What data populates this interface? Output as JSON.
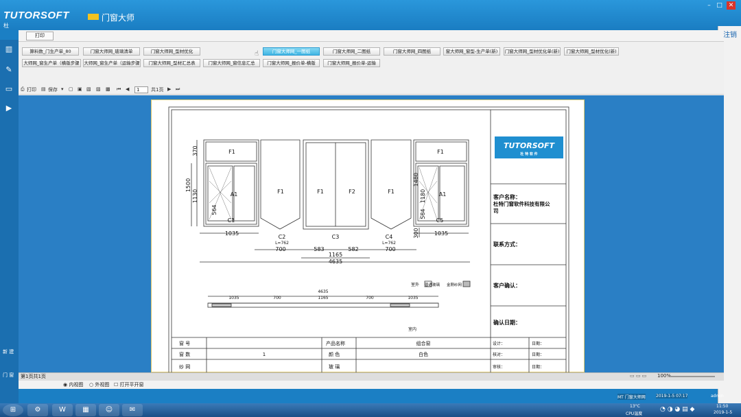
{
  "app": {
    "brand_logo": "TUTORSOFT",
    "brand_cn": "门窗大师",
    "user_char": "杜",
    "window_controls": [
      "–",
      "□",
      "✕"
    ]
  },
  "menubar": {
    "print_label": "打印"
  },
  "tabs_row1": [
    {
      "label": "算料数_门生产单_80"
    },
    {
      "label": "门窗大师网_玻璃清单"
    },
    {
      "label": "门窗大师网_型材优化"
    },
    {
      "label": "门窗大师网_一图纸",
      "active": true
    },
    {
      "label": "门窗大师网_二图纸"
    },
    {
      "label": "门窗大师网_四图纸"
    },
    {
      "label": "窗大师网_窗型-生产单(新)"
    },
    {
      "label": "门窗大师网_型材优化单(新)"
    },
    {
      "label": "门窗大师网_型材优化(新)"
    }
  ],
  "tabs_row2": [
    {
      "label": "大师网_窗生产单（横版步骤"
    },
    {
      "label": "大师网_窗生产单（运输步骤"
    },
    {
      "label": "门窗大师网_型材汇总表"
    },
    {
      "label": "门窗大师网_窗信息汇总"
    },
    {
      "label": "门窗大师网_报价单-横版"
    },
    {
      "label": "门窗大师网_报价单-运输"
    }
  ],
  "toolbar": {
    "print": "打印",
    "save": "保存",
    "page_value": "1",
    "page_total": "共1页"
  },
  "drawing": {
    "panels": {
      "top_fixed": "F1",
      "sash": "A1",
      "center_left": "F1",
      "center_right": "F2"
    },
    "labels": {
      "c1": "C1",
      "c2": "C2",
      "c3": "C3",
      "c4": "C4",
      "c5": "C5",
      "c2_len": "L=762",
      "c4_len": "L=762"
    },
    "dims": {
      "d370": "370",
      "d1500": "1500",
      "d1130": "1130",
      "d564": "564",
      "d1480": "1480",
      "d1180": "1180",
      "d300": "300",
      "d1035a": "1035",
      "d1035b": "1035",
      "d700a": "700",
      "d700b": "700",
      "d583": "583",
      "d582": "582",
      "d1165": "1165",
      "d4635": "4635"
    },
    "plan": {
      "outside_label": "室外",
      "legend_a": "普通玻璃",
      "legend_b": "金刚纱网",
      "inside_label": "室内",
      "total": "4635",
      "d1035a": "1035",
      "d700a": "700",
      "d1165": "1165",
      "d700b": "700",
      "d1035b": "1035"
    }
  },
  "info_panel": {
    "company_logo": "TUTORSOFT",
    "company_logo_sub": "杜 特 软 件",
    "customer_name_label": "客户名称：",
    "customer_name_1": "杜特门窗软件科技有限公",
    "customer_name_2": "司",
    "contact_label": "联系方式：",
    "confirm_label": "客户确认：",
    "date_label": "确认日期："
  },
  "bottom_table": {
    "row1": {
      "c1": "窗  号",
      "c2": "",
      "c3": "产品名称",
      "c4": "组合窗"
    },
    "row2": {
      "c1": "窗  数",
      "c2": "1",
      "c3": "颜  色",
      "c4": "白色"
    },
    "row3": {
      "c1": "纱  网",
      "c2": "",
      "c3": "玻  璃",
      "c4": ""
    },
    "sign": {
      "design": "设计：",
      "date1": "日期：",
      "check": "核对：",
      "date2": "日期：",
      "review": "审核：",
      "date3": "日期："
    }
  },
  "status": {
    "page_info": "第1页共1页",
    "zoom": "100%",
    "view_inner": "内视图",
    "view_outer": "外视图",
    "open_flat": "打开平开窗"
  },
  "side": {
    "item1": "新 建",
    "item2": "门 窗"
  },
  "right_pane": {
    "label": "注销"
  },
  "taskbar": {
    "apps": [
      "⊞",
      "⚙",
      "W",
      "▦",
      "☺",
      "✉"
    ],
    "task1": "MT 门窗大师网",
    "task2": "2019-1-5 07:17",
    "user": "admin",
    "temp": "13°C",
    "cpu": "CPU温度",
    "time": "11:50",
    "date": "2019-1-5"
  }
}
